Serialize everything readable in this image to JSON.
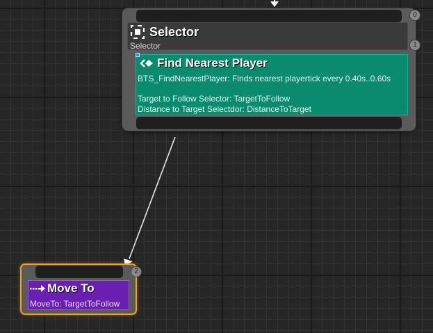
{
  "colors": {
    "canvas_background": "#262626",
    "node_frame": "#5a5a5a",
    "service_green": "#0a8a6e",
    "task_purple": "#6a1fb0",
    "selection_orange": "#f0a020"
  },
  "selector_node": {
    "title": "Selector",
    "subtitle": "Selector",
    "icon": "selector-icon",
    "top_badge": "0",
    "bottom_badge": "1",
    "service": {
      "icon": "service-icon",
      "title": "Find Nearest Player",
      "description": "BTS_FindNearestPlayer: Finds nearest playertick every 0.40s..0.60s",
      "line_target": "Target to Follow Selector: TargetToFollow",
      "line_distance": "Distance to Target Selectdor: DistanceToTarget"
    }
  },
  "move_to_node": {
    "title": "Move To",
    "icon": "move-to-icon",
    "subtitle": "MoveTo: TargetToFollow",
    "badge": "2"
  }
}
